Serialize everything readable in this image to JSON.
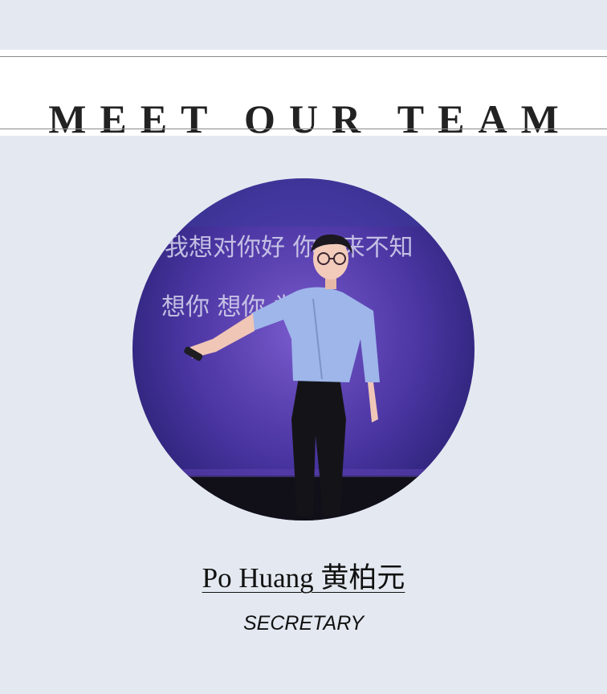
{
  "header": {
    "title": "MEET OUR TEAM"
  },
  "member": {
    "photo_icon": "team-member-photo",
    "screen_lines": [
      "我想对你好 你从来不知",
      "想你 想你 为嗜好"
    ],
    "name": "Po Huang 黄柏元",
    "role": "SECRETARY"
  },
  "colors": {
    "page_background": "#e4e9f1",
    "header_background": "#ffffff",
    "rule": "#8a8a8a",
    "text": "#111111"
  }
}
